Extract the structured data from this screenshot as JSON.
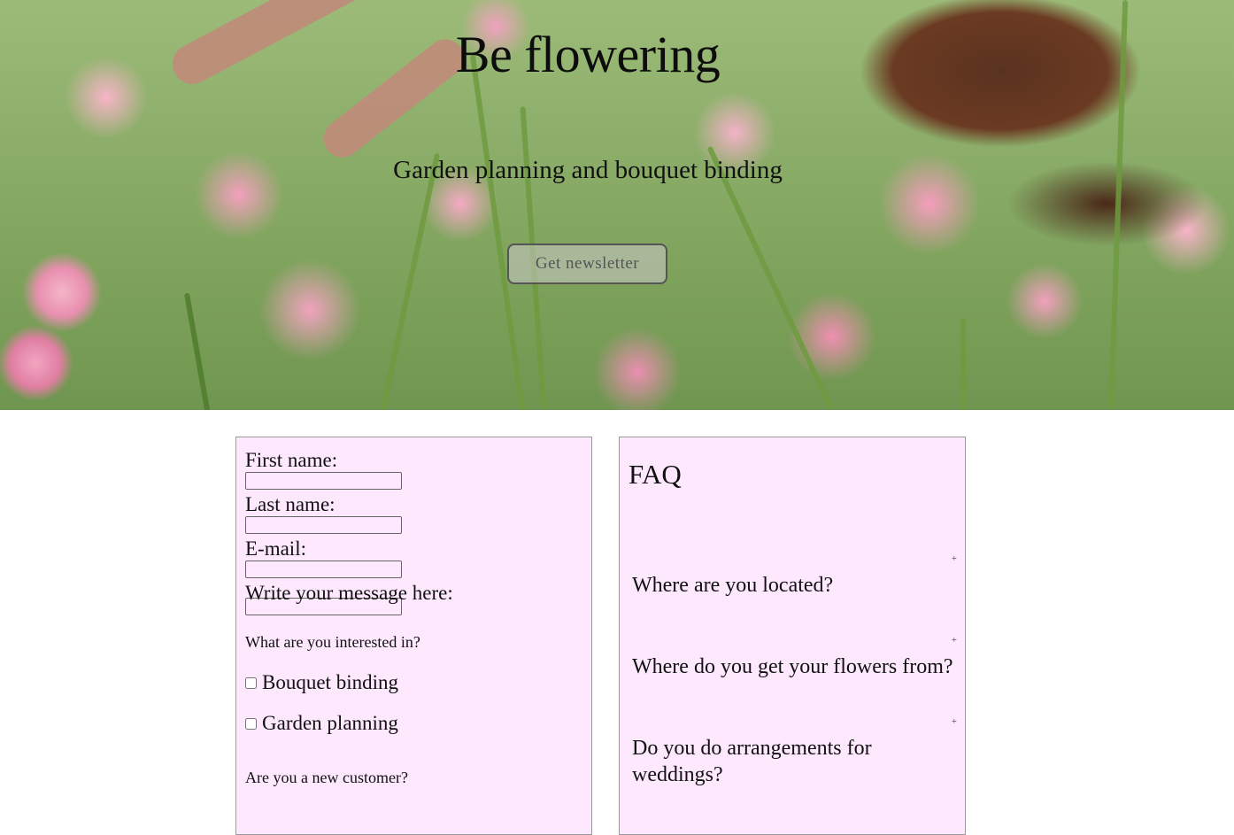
{
  "hero": {
    "title": "Be flowering",
    "subtitle": "Garden planning and bouquet binding",
    "newsletter_button": "Get newsletter"
  },
  "contact_form": {
    "first_name_label": "First name:",
    "last_name_label": "Last name:",
    "email_label": "E-mail:",
    "message_label": "Write your message here:",
    "interest_question": "What are you interested in?",
    "options": [
      {
        "label": "Bouquet binding",
        "checked": false
      },
      {
        "label": "Garden planning",
        "checked": false
      }
    ],
    "new_customer_question": "Are you a new customer?"
  },
  "faq": {
    "title": "FAQ",
    "toggle_symbol": "+",
    "questions": [
      "Where are you located?",
      "Where do you get your flowers from?",
      "Do you do arrangements for weddings?"
    ]
  },
  "colors": {
    "card_background": "#fde8fd",
    "card_border": "#9a9a9a",
    "hero_green": "#8cae6a",
    "flower_pink": "#f29fbe"
  }
}
